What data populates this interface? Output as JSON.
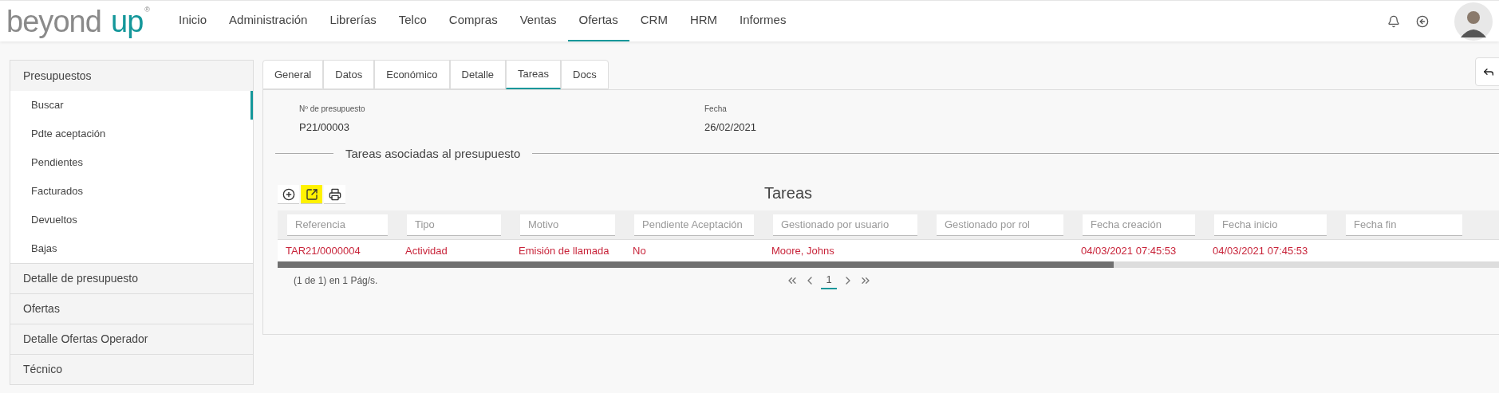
{
  "brand": {
    "word_1": "beyond",
    "word_2": "up",
    "mark": "®"
  },
  "nav": [
    {
      "label": "Inicio",
      "selected": false
    },
    {
      "label": "Administración",
      "selected": false
    },
    {
      "label": "Librerías",
      "selected": false
    },
    {
      "label": "Telco",
      "selected": false
    },
    {
      "label": "Compras",
      "selected": false
    },
    {
      "label": "Ventas",
      "selected": false
    },
    {
      "label": "Ofertas",
      "selected": true
    },
    {
      "label": "CRM",
      "selected": false
    },
    {
      "label": "HRM",
      "selected": false
    },
    {
      "label": "Informes",
      "selected": false
    }
  ],
  "sidebar": {
    "sections": [
      {
        "label": "Presupuestos",
        "expanded": true,
        "children": [
          {
            "label": "Buscar",
            "selected": true
          },
          {
            "label": "Pdte aceptación",
            "selected": false
          },
          {
            "label": "Pendientes",
            "selected": false
          },
          {
            "label": "Facturados",
            "selected": false
          },
          {
            "label": "Devueltos",
            "selected": false
          },
          {
            "label": "Bajas",
            "selected": false
          }
        ]
      },
      {
        "label": "Detalle de presupuesto",
        "expanded": false
      },
      {
        "label": "Ofertas",
        "expanded": false
      },
      {
        "label": "Detalle Ofertas Operador",
        "expanded": false
      },
      {
        "label": "Técnico",
        "expanded": false
      }
    ]
  },
  "tabs": [
    {
      "label": "General",
      "selected": false
    },
    {
      "label": "Datos",
      "selected": false
    },
    {
      "label": "Económico",
      "selected": false
    },
    {
      "label": "Detalle",
      "selected": false
    },
    {
      "label": "Tareas",
      "selected": true
    },
    {
      "label": "Docs",
      "selected": false
    }
  ],
  "fields": [
    {
      "label": "Nº de presupuesto",
      "value": "P21/00003"
    },
    {
      "label": "Fecha",
      "value": "26/02/2021"
    }
  ],
  "section_title": "Tareas asociadas al presupuesto",
  "toolbar": [
    {
      "kind": "add",
      "highlighted": false
    },
    {
      "kind": "export",
      "highlighted": true
    },
    {
      "kind": "print",
      "highlighted": false
    }
  ],
  "table": {
    "title": "Tareas",
    "columns": [
      {
        "placeholder": "Referencia"
      },
      {
        "placeholder": "Tipo"
      },
      {
        "placeholder": "Motivo"
      },
      {
        "placeholder": "Pendiente Aceptación"
      },
      {
        "placeholder": "Gestionado por usuario"
      },
      {
        "placeholder": "Gestionado por rol"
      },
      {
        "placeholder": "Fecha creación"
      },
      {
        "placeholder": "Fecha inicio"
      },
      {
        "placeholder": "Fecha fin"
      }
    ],
    "rows": [
      {
        "cells": [
          "TAR21/0000004",
          "Actividad",
          "Emisión de llamada",
          "No",
          "Moore, Johns",
          "",
          "04/03/2021 07:45:53",
          "04/03/2021 07:45:53",
          ""
        ]
      }
    ],
    "summary": "(1 de 1) en 1 Pág/s.",
    "pages": [
      {
        "label": "1",
        "selected": true
      }
    ]
  }
}
